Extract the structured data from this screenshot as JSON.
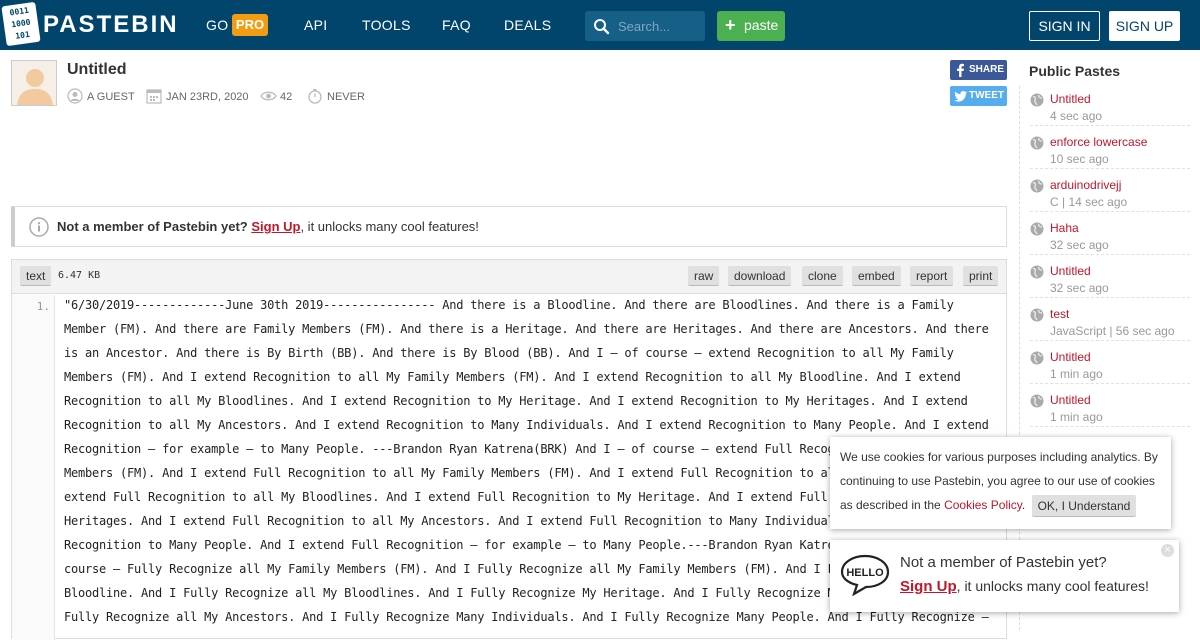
{
  "header": {
    "logo_icon_lines": [
      "0011",
      "1000",
      "101"
    ],
    "logo_text": "PASTEBIN",
    "nav": {
      "go": "GO",
      "pro": "PRO",
      "api": "API",
      "tools": "TOOLS",
      "faq": "FAQ",
      "deals": "DEALS"
    },
    "search_placeholder": "Search...",
    "paste_label": "paste",
    "sign_in": "SIGN IN",
    "sign_up": "SIGN UP"
  },
  "paste": {
    "title": "Untitled",
    "author": "A GUEST",
    "date": "JAN 23RD, 2020",
    "views": "42",
    "expires": "NEVER",
    "share_label": "SHARE",
    "tweet_label": "TWEET"
  },
  "notice": {
    "prefix": "Not a member of Pastebin yet?",
    "link": "Sign Up",
    "suffix": ", it unlocks many cool features!"
  },
  "code": {
    "syntax": "text",
    "size": "6.47 KB",
    "actions": [
      "raw",
      "download",
      "clone",
      "embed",
      "report",
      "print"
    ],
    "line_number": "1.",
    "lines": [
      "\"6/30/2019-------------June 30th 2019---------------- And there is a Bloodline. And there are Bloodlines. And there is a Family",
      "Member (FM). And there are Family Members (FM). And there is a Heritage. And there are Heritages. And there are Ancestors. And there",
      "is an Ancestor. And there is By Birth (BB). And there is By Blood (BB). And I – of course – extend Recognition to all My Family",
      "Members (FM). And I extend Recognition to all My Family Members (FM). And I extend Recognition to all My Bloodline. And I extend",
      "Recognition to all My Bloodlines. And I extend Recognition to My Heritage. And I extend Recognition to My Heritages. And I extend",
      "Recognition to all My Ancestors. And I extend Recognition to Many Individuals. And I extend Recognition to Many People. And I extend",
      "Recognition – for example – to Many People. ---Brandon Ryan Katrena(BRK) And I – of course – extend Full Recog",
      "Members (FM). And I extend Full Recognition to all My Family Members (FM). And I extend Full Recognition to al",
      "extend Full Recognition to all My Bloodlines. And I extend Full Recognition to My Heritage. And I extend Full",
      "Heritages. And I extend Full Recognition to all My Ancestors. And I extend Full Recognition to Many Individual",
      "Recognition to Many People. And I extend Full Recognition – for example – to Many People.---Brandon Ryan Katre",
      "course – Fully Recognize all My Family Members (FM). And I Fully Recognize all My Family Members (FM). And I F",
      "Bloodline. And I Fully Recognize all My Bloodlines. And I Fully Recognize My Heritage. And I Fully Recognize M",
      "Fully Recognize all My Ancestors. And I Fully Recognize Many Individuals. And I Fully Recognize Many People. And I Fully Recognize –"
    ]
  },
  "sidebar": {
    "title": "Public Pastes",
    "items": [
      {
        "title": "Untitled",
        "sub": "4 sec ago"
      },
      {
        "title": "enforce lowercase",
        "sub": "10 sec ago"
      },
      {
        "title": "arduinodrivejj",
        "sub": "C | 14 sec ago"
      },
      {
        "title": "Haha",
        "sub": "32 sec ago"
      },
      {
        "title": "Untitled",
        "sub": "32 sec ago"
      },
      {
        "title": "test",
        "sub": "JavaScript | 56 sec ago"
      },
      {
        "title": "Untitled",
        "sub": "1 min ago"
      },
      {
        "title": "Untitled",
        "sub": "1 min ago"
      }
    ]
  },
  "cookie": {
    "text": "We use cookies for various purposes including analytics. By continuing to use Pastebin, you agree to our use of cookies as described in the",
    "link": "Cookies Policy",
    "period": ".",
    "button": "OK, I Understand"
  },
  "hello_popup": {
    "bubble_text": "HELLO",
    "line1": "Not a member of Pastebin yet?",
    "link": "Sign Up",
    "suffix": ", it unlocks many cool features!",
    "close": "×"
  },
  "colors": {
    "header_bg": "#02456c",
    "accent_red": "#c0172a",
    "pro_orange": "#f39c12",
    "paste_green": "#4caf50",
    "facebook": "#3b5998",
    "twitter": "#55acee"
  }
}
